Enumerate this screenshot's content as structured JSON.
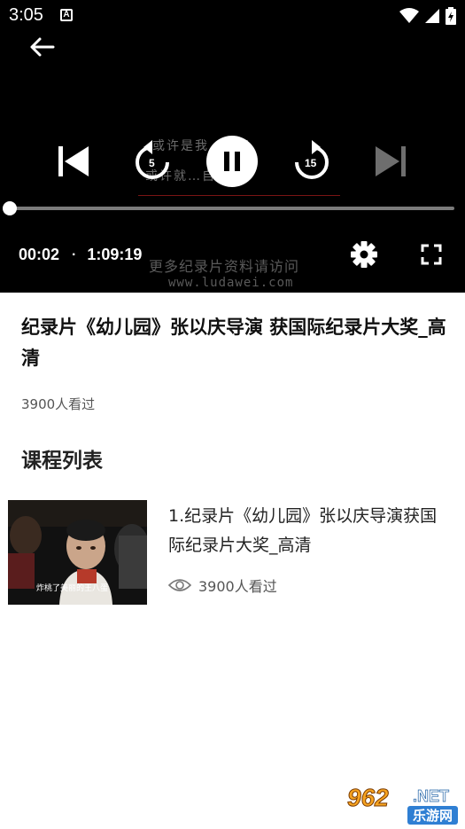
{
  "status_bar": {
    "time": "3:05",
    "notification_badge": "A",
    "icons": [
      "wifi-icon",
      "signal-icon",
      "battery-charging-icon"
    ]
  },
  "player": {
    "subtitle_lines": [
      "或许是我…孩子",
      "或许就…自己…"
    ],
    "watermark_line1": "更多纪录片资料请访问",
    "watermark_line2": "www.ludawei.com",
    "rewind_seconds": "5",
    "forward_seconds": "15",
    "current_time": "00:02",
    "separator": "·",
    "duration": "1:09:19",
    "progress": 0.0005
  },
  "video": {
    "title": "纪录片《幼儿园》张以庆导演 获国际纪录片大奖_高清",
    "views": "3900人看过"
  },
  "course_list": {
    "heading": "课程列表",
    "items": [
      {
        "title": "1.纪录片《幼儿园》张以庆导演获国际纪录片大奖_高清",
        "views": "3900人看过",
        "thumb_caption": "炸桃了美丽的王八蛋"
      }
    ]
  },
  "brand_watermark": {
    "number": "962",
    "domain": ".NET",
    "name": "乐游网"
  },
  "colors": {
    "player_bg": "#000000",
    "brand_orange": "#f7a420",
    "brand_blue": "#2f7fd3"
  }
}
